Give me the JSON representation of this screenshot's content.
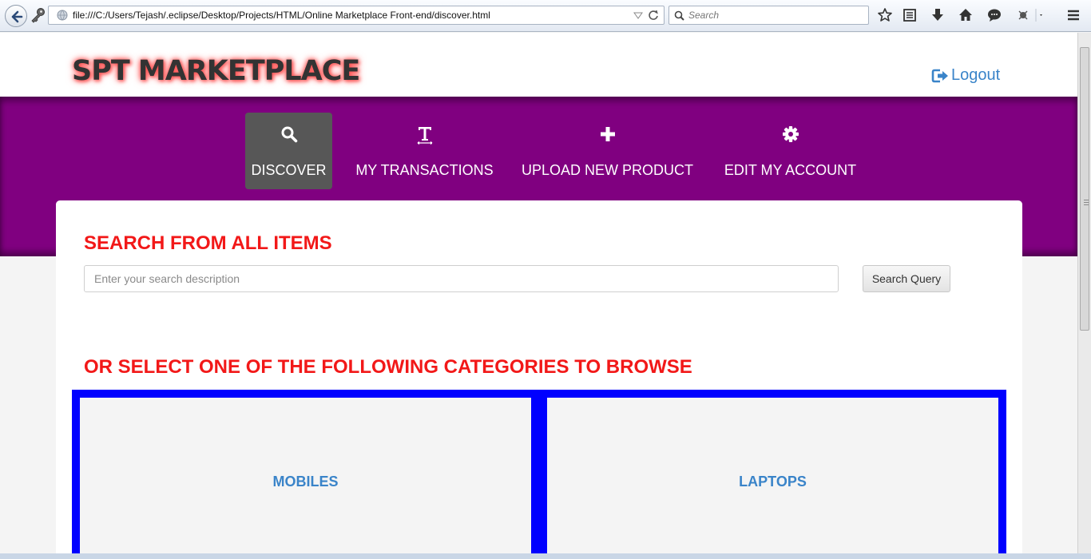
{
  "browser": {
    "url": "file:///C:/Users/Tejash/.eclipse/Desktop/Projects/HTML/Online Marketplace Front-end/discover.html",
    "search_placeholder": "Search",
    "toolbar_icons": [
      "bookmark-star-icon",
      "reading-list-icon",
      "download-icon",
      "home-icon",
      "chat-icon",
      "addon-icon",
      "menu-icon"
    ]
  },
  "header": {
    "brand": "SPT MARKETPLACE",
    "logout_label": "Logout"
  },
  "nav": {
    "items": [
      {
        "label": "DISCOVER",
        "icon": "search-icon",
        "active": true
      },
      {
        "label": "MY TRANSACTIONS",
        "icon": "text-icon",
        "active": false
      },
      {
        "label": "UPLOAD NEW PRODUCT",
        "icon": "plus-icon",
        "active": false
      },
      {
        "label": "EDIT MY ACCOUNT",
        "icon": "gear-icon",
        "active": false
      }
    ]
  },
  "search": {
    "heading": "SEARCH FROM ALL ITEMS",
    "placeholder": "Enter your search description",
    "value": "",
    "button_label": "Search Query"
  },
  "categories": {
    "heading": "OR SELECT ONE OF THE FOLLOWING CATEGORIES TO BROWSE",
    "items": [
      "MOBILES",
      "LAPTOPS"
    ]
  },
  "colors": {
    "band": "#800080",
    "heading_red": "#f21818",
    "link_blue": "#3a84c9",
    "category_border": "#0000ff"
  }
}
